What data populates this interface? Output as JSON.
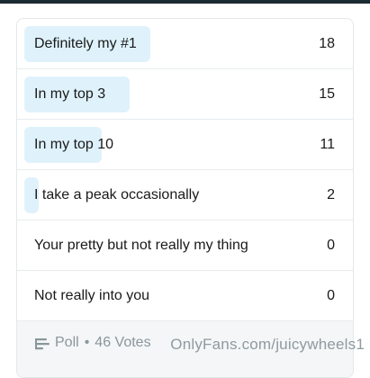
{
  "poll": {
    "options": [
      {
        "label": "Definitely my #1",
        "count": "18",
        "votes": 18
      },
      {
        "label": "In my top 3",
        "count": "15",
        "votes": 15
      },
      {
        "label": "In my top 10",
        "count": "11",
        "votes": 11
      },
      {
        "label": "I take a peak occasionally",
        "count": "2",
        "votes": 2
      },
      {
        "label": "Your pretty but not really my thing",
        "count": "0",
        "votes": 0
      },
      {
        "label": "Not really into you",
        "count": "0",
        "votes": 0
      }
    ],
    "footer": {
      "label": "Poll",
      "separator": "•",
      "votes_text": "46 Votes"
    }
  },
  "watermark": "OnlyFans.com/juicywheels1",
  "colors": {
    "bar_fill": "#dff2fc",
    "footer_bg": "#f4f6f7",
    "muted_text": "#8a969c"
  }
}
